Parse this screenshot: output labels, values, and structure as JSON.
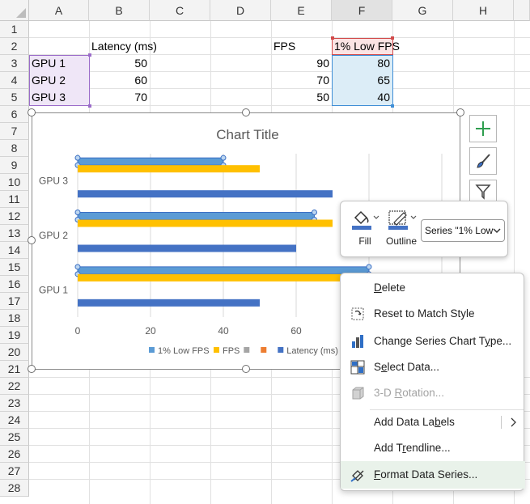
{
  "columns": [
    "A",
    "B",
    "C",
    "D",
    "E",
    "F",
    "G",
    "H"
  ],
  "rows": [
    "1",
    "2",
    "3",
    "4",
    "5",
    "6",
    "7",
    "8",
    "9",
    "10",
    "11",
    "12",
    "13",
    "14",
    "15",
    "16",
    "17",
    "18",
    "19",
    "20",
    "21",
    "22",
    "23",
    "24",
    "25",
    "26",
    "27",
    "28"
  ],
  "cells": {
    "B2": "Latency (ms)",
    "E2": "FPS",
    "F2": "1% Low FPS",
    "A3": "GPU 1",
    "B3": "50",
    "E3": "90",
    "F3": "80",
    "A4": "GPU 2",
    "B4": "60",
    "E4": "70",
    "F4": "65",
    "A5": "GPU 3",
    "B5": "70",
    "E5": "50",
    "F5": "40"
  },
  "chart_data": {
    "type": "bar",
    "orientation": "horizontal",
    "title": "Chart Title",
    "categories": [
      "GPU 1",
      "GPU 2",
      "GPU 3"
    ],
    "series": [
      {
        "name": "1% Low FPS",
        "values": [
          80,
          65,
          40
        ],
        "color": "#5b9bd5",
        "selected": true
      },
      {
        "name": "FPS",
        "values": [
          90,
          70,
          50
        ],
        "color": "#ffc000"
      },
      {
        "name": "",
        "values": [],
        "color": "#a5a5a5"
      },
      {
        "name": "",
        "values": [],
        "color": "#ed7d31"
      },
      {
        "name": "Latency (ms)",
        "values": [
          50,
          60,
          70
        ],
        "color": "#4472c4"
      }
    ],
    "xticks": [
      "0",
      "20",
      "40",
      "60",
      "80"
    ],
    "xlim": [
      0,
      100
    ],
    "legend_position": "bottom",
    "legend_visible_text": "1% Low FPS ■ FPS ■ ■ ■ Latency (m",
    "grid": true
  },
  "minibar": {
    "fill_label": "Fill",
    "outline_label": "Outline",
    "series_select_value": "Series \"1% Low"
  },
  "context_menu": {
    "delete": "Delete",
    "reset": "Reset to Match Style",
    "change_type": "Change Series Chart Type...",
    "select_data": "Select Data...",
    "rotation": "3-D Rotation...",
    "add_labels": "Add Data Labels",
    "add_trendline": "Add Trendline...",
    "format_series": "Format Data Series..."
  },
  "colors": {
    "accent_green": "#107c41",
    "selection_purple": "#9b6cc9",
    "selection_blue": "#3f8ed6",
    "selection_red": "#d14a4a"
  }
}
